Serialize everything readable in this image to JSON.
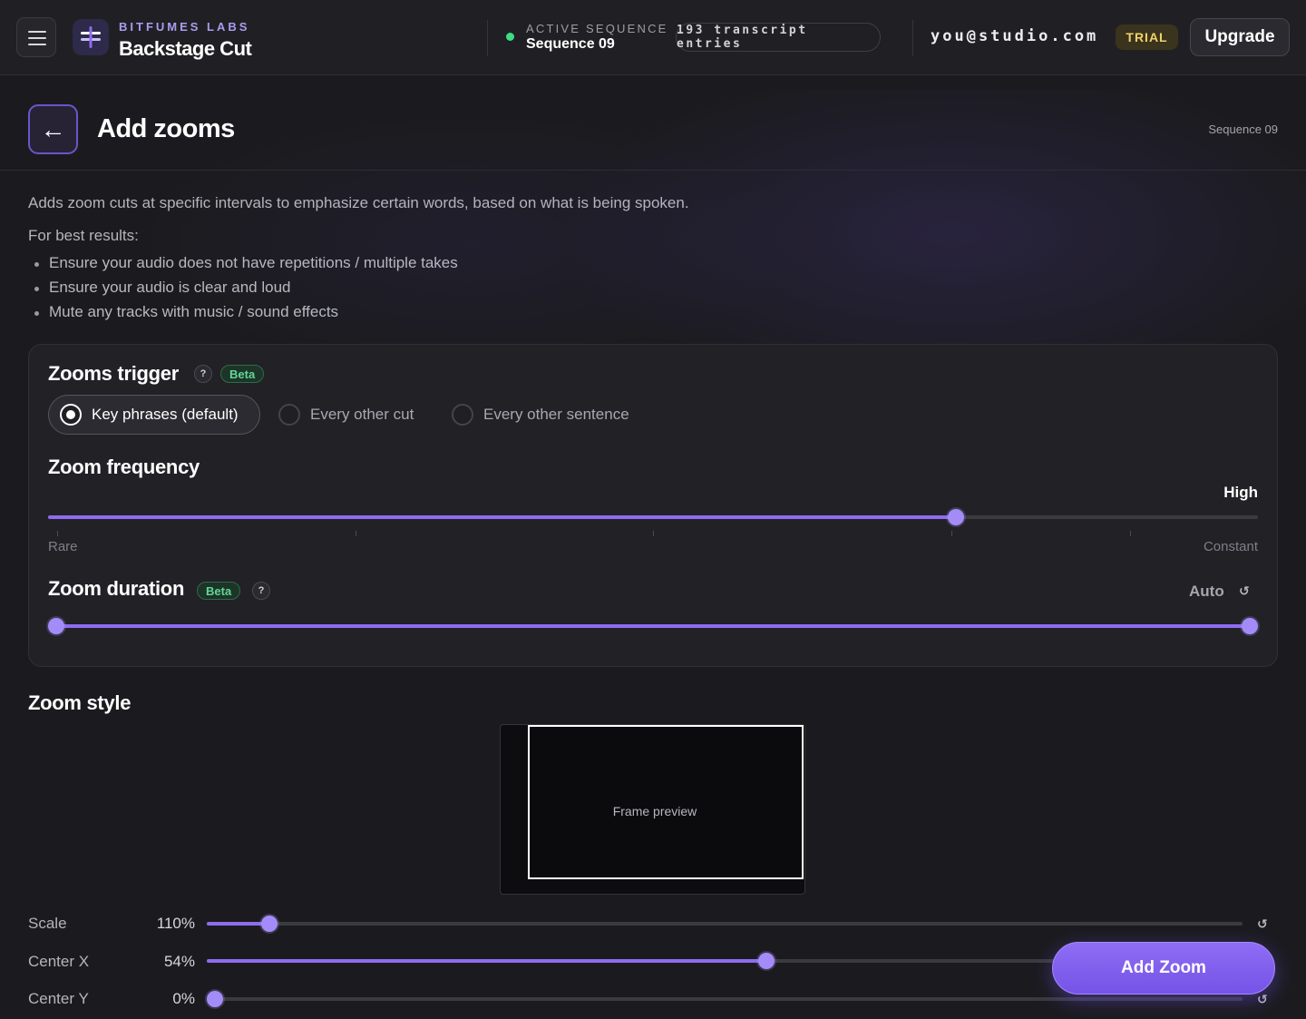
{
  "header": {
    "org_name": "BITFUMES LABS",
    "app_name": "Backstage Cut",
    "active_label": "ACTIVE SEQUENCE",
    "active_sequence": "Sequence 09",
    "entries": "193 transcript entries",
    "user_email": "you@studio.com",
    "trial_badge": "TRIAL",
    "upgrade_label": "Upgrade"
  },
  "page": {
    "back_icon": "←",
    "title": "Add zooms",
    "sequence": "Sequence 09",
    "description": "Adds zoom cuts at specific intervals to emphasize certain words, based on what is being spoken.",
    "best_results": "For best results:",
    "tips": [
      "Ensure your audio does not have repetitions / multiple takes",
      "Ensure your audio is clear and loud",
      "Mute any tracks with music / sound effects"
    ]
  },
  "trigger": {
    "title": "Zooms trigger",
    "help": "?",
    "badge": "Beta",
    "options": [
      {
        "label": "Key phrases (default)",
        "selected": true
      },
      {
        "label": "Every other cut",
        "selected": false
      },
      {
        "label": "Every other sentence",
        "selected": false
      }
    ]
  },
  "frequency": {
    "title": "Zoom frequency",
    "value_label": "High",
    "min_label": "Rare",
    "max_label": "Constant",
    "value": 0.75,
    "ticks": [
      0,
      0.25,
      0.5,
      0.75,
      0.9
    ]
  },
  "duration": {
    "title": "Zoom duration",
    "badge": "Beta",
    "help": "?",
    "value_label": "Auto",
    "reset_icon": "↺",
    "range": [
      0,
      1
    ]
  },
  "zoom_style": {
    "title": "Zoom style",
    "preview_label": "Frame preview",
    "reset_icon": "↺",
    "params": [
      {
        "label": "Scale",
        "value": "110%",
        "fraction": 0.06
      },
      {
        "label": "Center X",
        "value": "54%",
        "fraction": 0.54
      },
      {
        "label": "Center Y",
        "value": "0%",
        "fraction": 0.0
      }
    ]
  },
  "actions": {
    "add_zoom": "Add Zoom"
  },
  "colors": {
    "accent": "#8e6cf0",
    "beta_green": "#62d796",
    "trial_gold": "#f0d26a",
    "active_green": "#3ddc84"
  }
}
